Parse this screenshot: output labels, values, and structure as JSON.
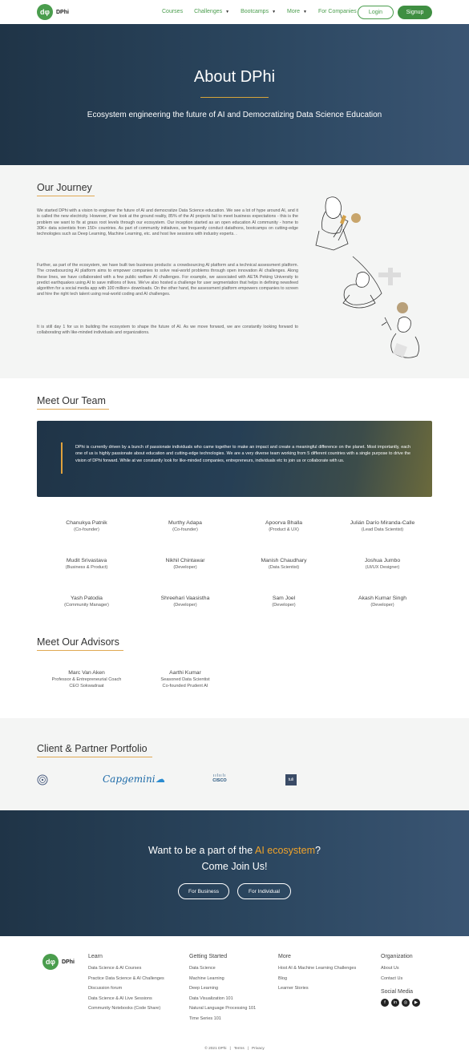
{
  "nav": {
    "logo_mark": "dφ",
    "logo_text": "DPhi",
    "links": [
      {
        "label": "Courses",
        "dropdown": false
      },
      {
        "label": "Challenges",
        "dropdown": true
      },
      {
        "label": "Bootcamps",
        "dropdown": true
      },
      {
        "label": "More",
        "dropdown": true
      },
      {
        "label": "For Companies",
        "dropdown": false
      }
    ],
    "login": "Login",
    "signup": "Signup"
  },
  "hero": {
    "title": "About DPhi",
    "subtitle": "Ecosystem engineering the future of AI and Democratizing Data Science Education"
  },
  "journey": {
    "heading": "Our Journey",
    "p1": "We started DPhi with a vision to engineer the future of AI and democratize Data Science education. We see a lot of hype around AI, and it is called the new electricity. However, if we look at the ground reality, 85% of the AI projects fail to meet business expectations - this is the problem we want to fix at grass root levels through our ecosystem. Our inception started as an open education AI community - home to 30K+ data scientists from 150+ countries. As part of community initiatives, we frequently conduct datathons, bootcamps on cutting-edge technologies such as Deep Learning, Machine Learning, etc. and host live sessions with industry experts. .",
    "p2": "Further, as part of the ecosystem, we have built two business products: a crowdsourcing AI platform and a technical assessment platform. The crowdsourcing AI platform aims to empower companies to solve real-world problems through open innovation AI challenges. Along these lines, we have collaborated with a few public welfare AI challenges. For example, we associated with AETA Peking University to predict earthquakes using AI to save millions of lives. We've also hosted a challenge for user segmentation that helps in defining newsfeed algorithm for a social media app with 100 million+ downloads. On the other hand, the assessment platform empowers companies to screen and hire the right tech talent using real-world coding and AI challenges.",
    "p3": "It is still day 1 for us in building the ecosystem to shape the future of AI. As we move forward, we are constantly looking forward to collaborating with like-minded individuals and organizations."
  },
  "team": {
    "heading": "Meet Our Team",
    "intro": "DPhi is currently driven by a bunch of passionate individuals who came together to make an impact and create a meaningful difference on the planet. Most importantly, each one of us is highly passionate about education and cutting-edge technologies. We are a very diverse team working from 5 different countries with a single purpose to drive the vision of DPhi forward. While at we constantly look for like-minded companies, entrepreneurs, individuals etc to join us or collaborate with us.",
    "members": [
      {
        "name": "Chanukya Patnik",
        "role": "(Co-founder)"
      },
      {
        "name": "Murthy Adapa",
        "role": "(Co-founder)"
      },
      {
        "name": "Apoorva Bhalla",
        "role": "(Product & UX)"
      },
      {
        "name": "Julián Darío Miranda-Calle",
        "role": "(Lead Data Scientist)"
      },
      {
        "name": "Mudit Srivastava",
        "role": "(Business & Product)"
      },
      {
        "name": "Nikhil Chintawar",
        "role": "(Developer)"
      },
      {
        "name": "Manish Chaudhary",
        "role": "(Data Scientist)"
      },
      {
        "name": "Joshua Jumbo",
        "role": "(UI/UX Designer)"
      },
      {
        "name": "Yash Patodia",
        "role": "(Community Manager)"
      },
      {
        "name": "Shreehari Vaasistha",
        "role": "(Developer)"
      },
      {
        "name": "Sam Joel",
        "role": "(Developer)"
      },
      {
        "name": "Akash Kumar Singh",
        "role": "(Developer)"
      }
    ]
  },
  "advisors": {
    "heading": "Meet Our Advisors",
    "list": [
      {
        "name": "Marc Van Aken",
        "line1": "Professor & Entrepreneurial Coach",
        "line2": "CEO Sokwadraat"
      },
      {
        "name": "Aarthi Kumar",
        "line1": "Seasoned Data Scientist",
        "line2": "Co-founded Prudent AI"
      }
    ]
  },
  "portfolio": {
    "heading": "Client & Partner Portfolio",
    "logos": [
      "Capgemini",
      "CISCO",
      "tuli"
    ]
  },
  "cta": {
    "line1_pre": "Want to be a part of the ",
    "line1_highlight": "AI ecosystem",
    "line1_post": "?",
    "line2": "Come Join Us!",
    "business": "For Business",
    "individual": "For Individual",
    "accent": "#f0a32a"
  },
  "footer": {
    "logo_mark": "dφ",
    "logo_text": "DPhi",
    "learn": {
      "heading": "Learn",
      "items": [
        "Data Science & AI Courses",
        "Practice Data Science & AI Challenges",
        "Discussion forum",
        "Data Science & AI Live Sessions",
        "Community Notebooks (Code Share)"
      ]
    },
    "getting_started": {
      "heading": "Getting Started",
      "items": [
        "Data Science",
        "Machine Learning",
        "Deep Learning",
        "Data Visualization 101",
        "Natural Language Processing 101",
        "Time Series 101"
      ]
    },
    "more": {
      "heading": "More",
      "items": [
        "Host AI & Machine Learning Challenges",
        "Blog",
        "Learner Stories"
      ]
    },
    "organization": {
      "heading": "Organization",
      "items": [
        "About Us",
        "Contact Us"
      ]
    },
    "social_heading": "Social Media",
    "social": [
      "facebook-icon",
      "linkedin-icon",
      "instagram-icon",
      "youtube-icon"
    ],
    "copyright": "© 2021 DPhi",
    "terms": "Terms",
    "privacy": "Privacy"
  }
}
